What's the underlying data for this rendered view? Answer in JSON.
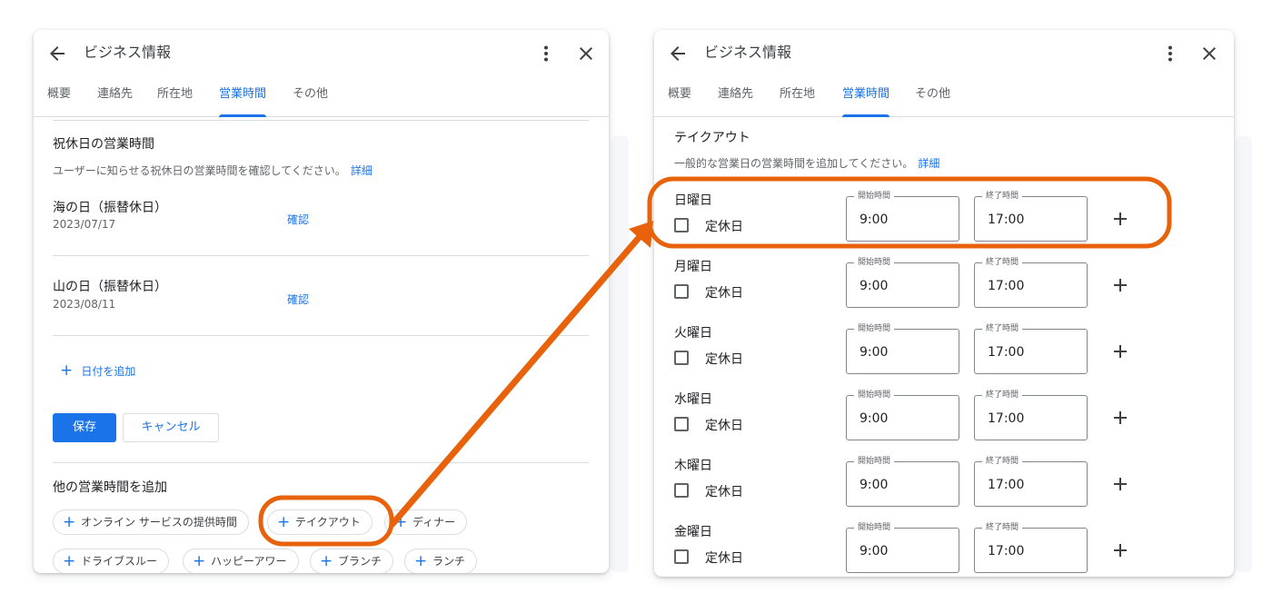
{
  "left": {
    "title": "ビジネス情報",
    "tabs": [
      "概要",
      "連絡先",
      "所在地",
      "営業時間",
      "その他"
    ],
    "section_title": "祝休日の営業時間",
    "section_desc": "ユーザーに知らせる祝休日の営業時間を確認してください。",
    "details_link": "詳細",
    "holidays": [
      {
        "name": "海の日（振替休日）",
        "date": "2023/07/17",
        "action": "確認"
      },
      {
        "name": "山の日（振替休日）",
        "date": "2023/08/11",
        "action": "確認"
      }
    ],
    "add_date": "日付を追加",
    "save": "保存",
    "cancel": "キャンセル",
    "other_hours_title": "他の営業時間を追加",
    "chips": [
      "オンライン サービスの提供時間",
      "テイクアウト",
      "ディナー",
      "ドライブスルー",
      "ハッピーアワー",
      "ブランチ",
      "ランチ"
    ]
  },
  "right": {
    "title": "ビジネス情報",
    "tabs": [
      "概要",
      "連絡先",
      "所在地",
      "営業時間",
      "その他"
    ],
    "section_title": "テイクアウト",
    "section_desc": "一般的な営業日の営業時間を追加してください。",
    "details_link": "詳細",
    "start_label": "開始時間",
    "end_label": "終了時間",
    "closed_label": "定休日",
    "days": [
      {
        "day": "日曜日",
        "start": "9:00",
        "end": "17:00"
      },
      {
        "day": "月曜日",
        "start": "9:00",
        "end": "17:00"
      },
      {
        "day": "火曜日",
        "start": "9:00",
        "end": "17:00"
      },
      {
        "day": "水曜日",
        "start": "9:00",
        "end": "17:00"
      },
      {
        "day": "木曜日",
        "start": "9:00",
        "end": "17:00"
      },
      {
        "day": "金曜日",
        "start": "9:00",
        "end": "17:00"
      }
    ]
  },
  "colors": {
    "accent": "#1a73e8",
    "annotation": "#e8620c",
    "divider": "#dadce0"
  },
  "icons": {
    "back": "arrow-left-icon",
    "more": "more-vert-icon",
    "close": "close-icon",
    "add": "plus-icon"
  }
}
